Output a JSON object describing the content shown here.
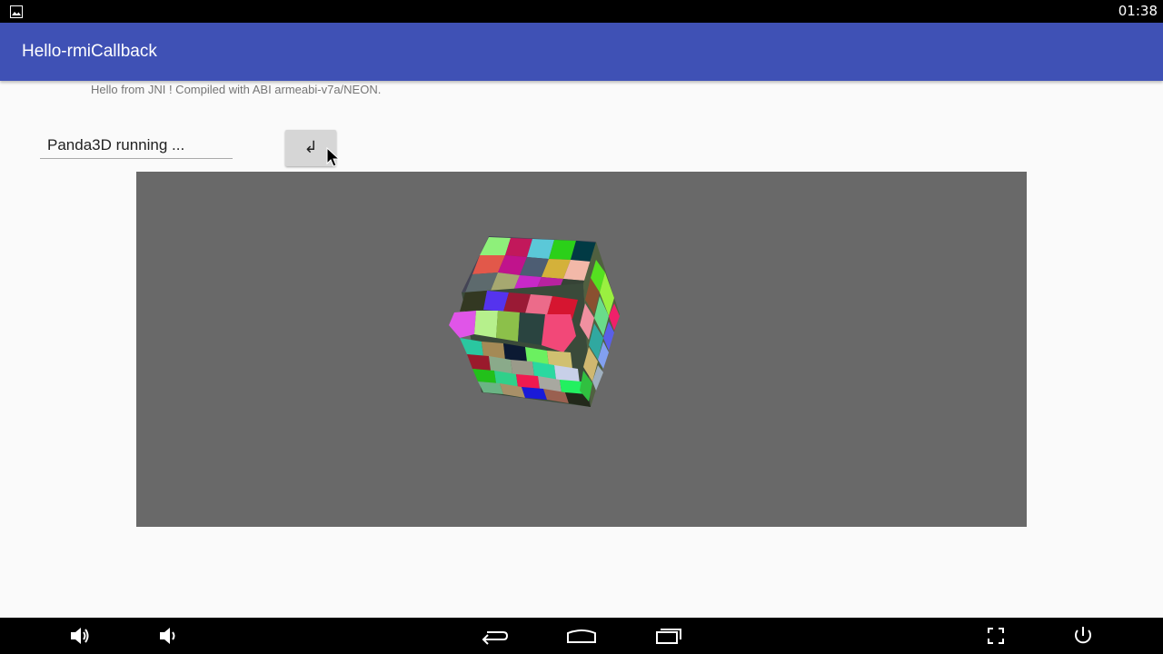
{
  "status_bar": {
    "clock": "01:38",
    "notification_icon": "image-icon"
  },
  "app_bar": {
    "title": "Hello-rmiCallback"
  },
  "main": {
    "jni_message": "Hello from JNI !  Compiled with ABI armeabi-v7a/NEON.",
    "status_field": {
      "value": "Panda3D running ..."
    },
    "enter_button": {
      "label": "↲"
    },
    "render_viewport": {
      "background": "#696969",
      "content": "cube-render"
    }
  },
  "nav_bar": {
    "buttons": [
      "volume-up-icon",
      "volume-down-icon",
      "back-icon",
      "home-icon",
      "recents-icon",
      "fullscreen-icon",
      "power-icon"
    ]
  },
  "colors": {
    "app_bar": "#3f51b5",
    "status_bar": "#000000",
    "background": "#fafafa",
    "viewport": "#696969"
  }
}
